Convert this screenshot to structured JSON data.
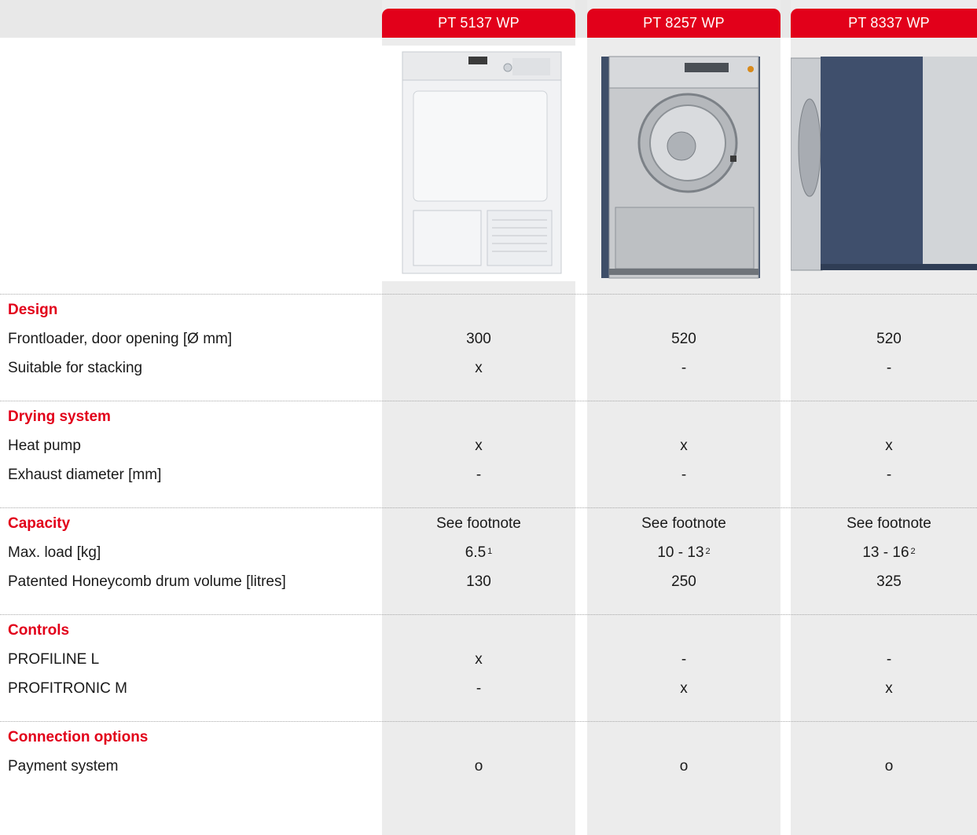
{
  "products": [
    {
      "name": "PT 5137 WP"
    },
    {
      "name": "PT 8257 WP"
    },
    {
      "name": "PT 8337 WP"
    }
  ],
  "sections": [
    {
      "title": "Design",
      "rows": [
        {
          "label": "Frontloader, door opening [Ø mm]",
          "values": [
            "300",
            "520",
            "520"
          ],
          "sups": [
            "",
            "",
            ""
          ]
        },
        {
          "label": "Suitable for stacking",
          "values": [
            "x",
            "-",
            "-"
          ],
          "sups": [
            "",
            "",
            ""
          ]
        }
      ]
    },
    {
      "title": "Drying system",
      "rows": [
        {
          "label": "Heat pump",
          "values": [
            "x",
            "x",
            "x"
          ],
          "sups": [
            "",
            "",
            ""
          ]
        },
        {
          "label": "Exhaust diameter [mm]",
          "values": [
            "-",
            "-",
            "-"
          ],
          "sups": [
            "",
            "",
            ""
          ]
        }
      ]
    },
    {
      "title": "Capacity",
      "values": [
        "See footnote",
        "See footnote",
        "See footnote"
      ],
      "rows": [
        {
          "label": "Max. load [kg]",
          "values": [
            "6.5",
            "10 - 13",
            "13 - 16"
          ],
          "sups": [
            "1",
            "2",
            "2"
          ]
        },
        {
          "label": "Patented Honeycomb drum  volume [litres]",
          "values": [
            "130",
            "250",
            "325"
          ],
          "sups": [
            "",
            "",
            ""
          ]
        }
      ]
    },
    {
      "title": "Controls",
      "rows": [
        {
          "label": "PROFILINE L",
          "values": [
            "x",
            "-",
            "-"
          ],
          "sups": [
            "",
            "",
            ""
          ]
        },
        {
          "label": "PROFITRONIC M",
          "values": [
            "-",
            "x",
            "x"
          ],
          "sups": [
            "",
            "",
            ""
          ]
        }
      ]
    },
    {
      "title": "Connection options",
      "rows": [
        {
          "label": "Payment system",
          "values": [
            "o",
            "o",
            "o"
          ],
          "sups": [
            "",
            "",
            ""
          ]
        }
      ]
    }
  ],
  "colors": {
    "accent": "#e2001a",
    "column_bg": "#ececec",
    "topbar_bg": "#e8e8e8"
  }
}
